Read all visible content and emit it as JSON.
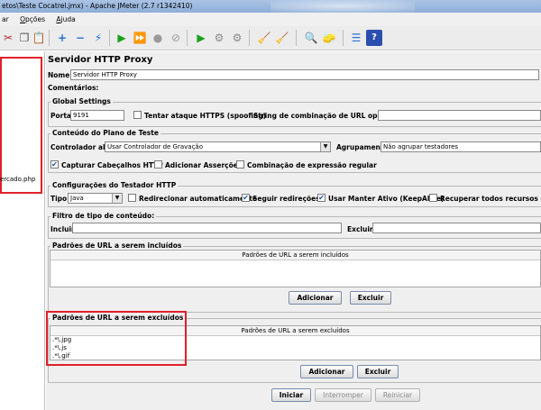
{
  "window": {
    "title": "etos\\Teste Cocatrel.jmx) - Apache JMeter (2.7 r1342410)"
  },
  "menu": {
    "items": [
      "ar",
      "Opções",
      "Ajuda"
    ]
  },
  "tree": {
    "item_label": "ercado.php"
  },
  "main": {
    "title": "Servidor HTTP Proxy",
    "name_label": "Nome:",
    "name_value": "Servidor HTTP Proxy",
    "comments_label": "Comentários:",
    "global": {
      "title": "Global Settings",
      "port_label": "Porta:",
      "port_value": "9191",
      "https_label": "Tentar ataque  HTTPS (spoofing)",
      "url_combo_label": "String de combinação de URL opcional:"
    },
    "plan": {
      "title": "Conteúdo do Plano de Teste",
      "target_label": "Controlador alvo:",
      "target_value": "Usar Controlador de Gravação",
      "group_label": "Agrupamento:",
      "group_value": "Não agrupar testadores",
      "capture_headers": "Capturar Cabeçalhos HTTP",
      "add_assertions": "Adicionar Asserções",
      "regex_match": "Combinação de expressão regular"
    },
    "sampler": {
      "title": "Configurações do Testador HTTP",
      "type_label": "Tipo:",
      "type_value": "Java",
      "redirect_auto": "Redirecionar automaticamente",
      "follow_redirects": "Seguir redireções",
      "keepalive": "Usar Manter Ativo (KeepAlive)",
      "retrieve_all": "Recuperar todos recursos embu"
    },
    "content_filter": {
      "title": "Filtro de tipo de conteúdo:",
      "include_label": "Incluir:",
      "exclude_label": "Excluir:"
    },
    "include_patterns": {
      "title": "Padrões de URL a serem incluídos",
      "header": "Padrões de URL a serem incluídos",
      "add_label": "Adicionar",
      "delete_label": "Excluir"
    },
    "exclude_patterns": {
      "title": "Padrões de URL a serem excluídos",
      "header": "Padrões de URL a serem excluídos",
      "rows": [
        ".*\\.jpg",
        ".*\\.js",
        ".*\\.gif"
      ],
      "add_label": "Adicionar",
      "delete_label": "Excluir"
    },
    "footer": {
      "start_label": "Iniciar",
      "stop_label": "Interromper",
      "restart_label": "Reiniciar"
    }
  },
  "colors": {
    "highlight": "#e0202a",
    "checkbox": "#1a4fa0"
  },
  "toolbar": {
    "icons": [
      "cut-icon",
      "copy-icon",
      "paste-icon",
      "expand-icon",
      "collapse-icon",
      "toggle-icon",
      "start-icon",
      "start-no-pause-icon",
      "stop-icon",
      "shutdown-icon",
      "remote-start-icon",
      "remote-stop-icon",
      "remote-shutdown-icon",
      "clear-icon",
      "clear-all-icon",
      "search-icon",
      "reset-search-icon",
      "function-helper-icon",
      "help-icon"
    ]
  }
}
